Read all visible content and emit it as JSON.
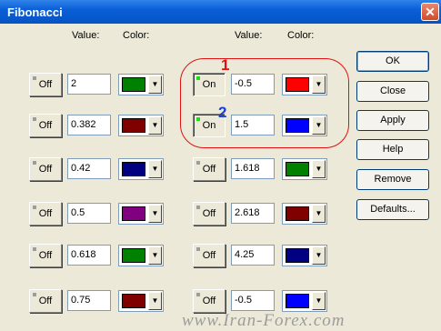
{
  "window": {
    "title": "Fibonacci",
    "close_glyph": "✕"
  },
  "headers": {
    "value": "Value:",
    "color": "Color:"
  },
  "left_rows": [
    {
      "state": "Off",
      "value": "2",
      "color": "#008000"
    },
    {
      "state": "Off",
      "value": "0.382",
      "color": "#800000"
    },
    {
      "state": "Off",
      "value": "0.42",
      "color": "#000080"
    },
    {
      "state": "Off",
      "value": "0.5",
      "color": "#800080"
    },
    {
      "state": "Off",
      "value": "0.618",
      "color": "#008000"
    },
    {
      "state": "Off",
      "value": "0.75",
      "color": "#800000"
    }
  ],
  "right_rows": [
    {
      "state": "On",
      "value": "-0.5",
      "color": "#ff0000"
    },
    {
      "state": "On",
      "value": "1.5",
      "color": "#0000ff"
    },
    {
      "state": "Off",
      "value": "1.618",
      "color": "#008000"
    },
    {
      "state": "Off",
      "value": "2.618",
      "color": "#800000"
    },
    {
      "state": "Off",
      "value": "4.25",
      "color": "#000080"
    },
    {
      "state": "Off",
      "value": "-0.5",
      "color": "#0000ff"
    }
  ],
  "buttons": [
    "OK",
    "Close",
    "Apply",
    "Help",
    "Remove",
    "Defaults..."
  ],
  "annotations": [
    {
      "label": "1",
      "color": "#e01010"
    },
    {
      "label": "2",
      "color": "#1a3ed8"
    }
  ],
  "watermark": "www.Iran-Forex.com",
  "icons": {
    "dropdown": "▼"
  }
}
